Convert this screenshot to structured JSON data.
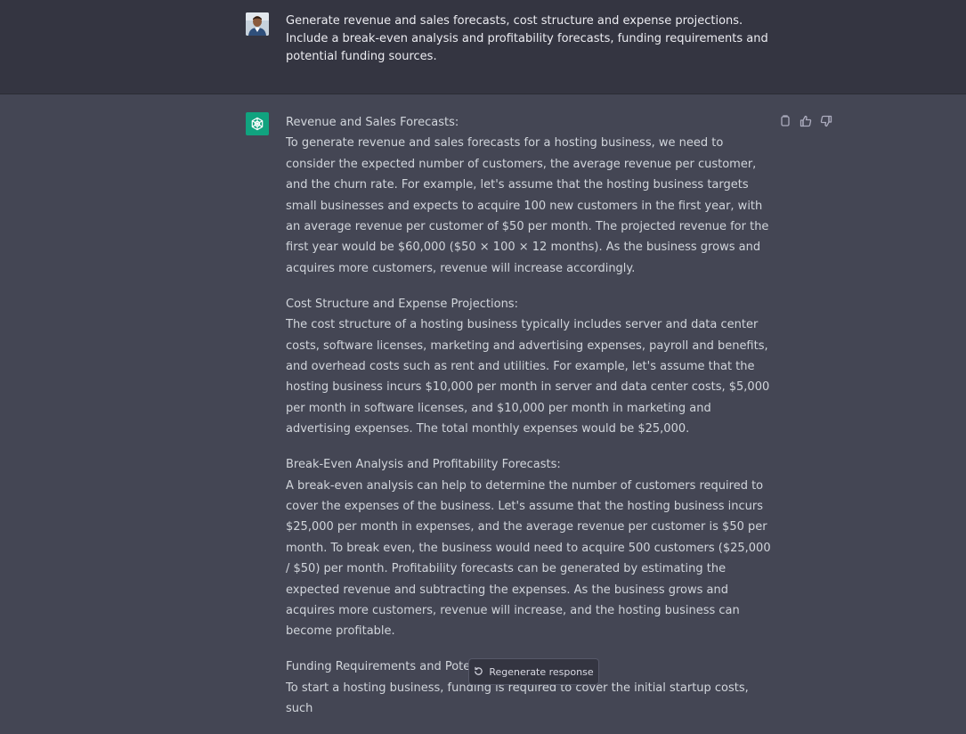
{
  "user_message": {
    "avatar": "user-photo",
    "text": "Generate revenue and sales forecasts, cost structure and expense projections. Include a break-even analysis and profitability forecasts, funding requirements and potential funding sources."
  },
  "assistant_message": {
    "avatar": "openai-logo-icon",
    "sections": [
      {
        "heading": "Revenue and Sales Forecasts:",
        "body": "To generate revenue and sales forecasts for a hosting business, we need to consider the expected number of customers, the average revenue per customer, and the churn rate. For example, let's assume that the hosting business targets small businesses and expects to acquire 100 new customers in the first year, with an average revenue per customer of $50 per month. The projected revenue for the first year would be $60,000 ($50 × 100 × 12 months). As the business grows and acquires more customers, revenue will increase accordingly."
      },
      {
        "heading": "Cost Structure and Expense Projections:",
        "body": "The cost structure of a hosting business typically includes server and data center costs, software licenses, marketing and advertising expenses, payroll and benefits, and overhead costs such as rent and utilities. For example, let's assume that the hosting business incurs $10,000 per month in server and data center costs, $5,000 per month in software licenses, and $10,000 per month in marketing and advertising expenses. The total monthly expenses would be $25,000."
      },
      {
        "heading": "Break-Even Analysis and Profitability Forecasts:",
        "body": "A break-even analysis can help to determine the number of customers required to cover the expenses of the business. Let's assume that the hosting business incurs $25,000 per month in expenses, and the average revenue per customer is $50 per month. To break even, the business would need to acquire 500 customers ($25,000 / $50) per month. Profitability forecasts can be generated by estimating the expected revenue and subtracting the expenses. As the business grows and acquires more customers, revenue will increase, and the hosting business can become profitable."
      },
      {
        "heading": "Funding Requirements and Potential Funding Sources:",
        "body": "To start a hosting business, funding is required to cover the initial startup costs, such"
      }
    ],
    "actions": [
      "copy-icon",
      "thumbs-up-icon",
      "thumbs-down-icon"
    ]
  },
  "regenerate_button": {
    "label": "Regenerate response",
    "icon": "refresh-icon"
  }
}
